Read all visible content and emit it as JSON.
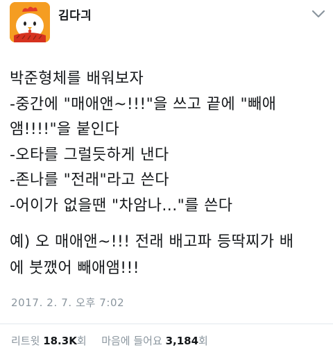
{
  "author": {
    "name": "김다긔",
    "avatar_icon": "chicken-mascot-icon",
    "menu_icon": "chevron-down-icon"
  },
  "tweet": {
    "lines": [
      "박준형체를 배워보자",
      "-중간에 \"매애앤~!!!\"을 쓰고 끝에 \"빼애",
      "앰!!!!\"을 붙인다",
      "-오타를 그럴듯하게 낸다",
      "-존나를 \"전래\"라고 쓴다",
      "-어이가 없을땐 \"차암나...\"를 쓴다"
    ],
    "example_lines": [
      "예) 오 매애앤~!!! 전래 배고파 등딱찌가 배",
      "에 붓깼어 빼애앰!!!"
    ]
  },
  "timestamp": "2017. 2. 7. 오후 7:02",
  "stats": {
    "retweet_label": "리트윗",
    "retweet_count": "18.3K",
    "retweet_unit": "회",
    "like_label": "마음에 들어요",
    "like_count": "3,184",
    "like_unit": "회"
  },
  "colors": {
    "text": "#14171a",
    "muted": "#8a959e",
    "avatar_bg": "#f59d22"
  }
}
